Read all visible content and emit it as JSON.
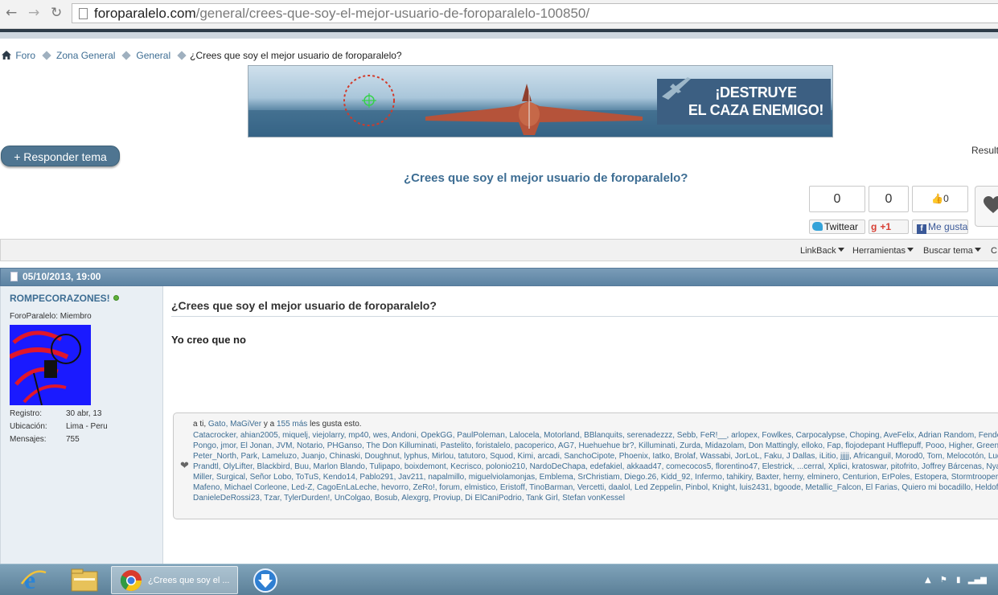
{
  "browser": {
    "url_host": "foroparalelo.com",
    "url_path": "/general/crees-que-soy-el-mejor-usuario-de-foroparalelo-100850/"
  },
  "breadcrumb": {
    "items": [
      "Foro",
      "Zona General",
      "General"
    ],
    "current": "¿Crees que soy el mejor usuario de foroparalelo?"
  },
  "banner": {
    "line1": "¡DESTRUYE",
    "line2": "EL CAZA ENEMIGO!"
  },
  "actions": {
    "reply_label": "+ Responder tema",
    "results_label": "Result"
  },
  "thread": {
    "title": "¿Crees que soy el mejor usuario de foroparalelo?"
  },
  "share": {
    "twitter_count": "0",
    "twitter_label": "Twittear",
    "gplus_count": "0",
    "gplus_label": "+1",
    "fb_count": "0",
    "fb_label": "Me gusta"
  },
  "toolbar": {
    "linkback": "LinkBack",
    "herramientas": "Herramientas",
    "buscar": "Buscar tema",
    "extra": "C"
  },
  "post": {
    "date": "05/10/2013, 19:00",
    "title": "¿Crees que soy el mejor usuario de foroparalelo?",
    "message": "Yo creo que no"
  },
  "user": {
    "name": "ROMPECORAZONES!",
    "title": "ForoParalelo: Miembro",
    "stats": [
      {
        "label": "Registro:",
        "value": "30 abr, 13"
      },
      {
        "label": "Ubicación:",
        "value": "Lima - Peru"
      },
      {
        "label": "Mensajes:",
        "value": "755"
      }
    ]
  },
  "likes": {
    "prefix": "a ti, ",
    "first_names": "Gato, MaGiVer",
    "middle": " y a ",
    "count_link": "155 más",
    "suffix": " les gusta esto.",
    "names": "Catacrocker, ahian2005, miquelj, viejolarry, mp40, wes, Andoni, OpekGG, PaulPoleman, Lalocela, Motorland, BBlanquits, serenadezzz, Sebb, FeR!__, arlopex, Fowlkes, Carpocalypse, Choping, AveFelix, Adrian Random, Fende, Pongo, jmor, El Jonan, JVM, Notario, PHGanso, The Don Killuminati, Pastelito, foristalelo, pacoperico, AG7, Huehuehue br?, Killuminati, Zurda, Midazolam, Don Mattingly, elloko, Fap, flojodepant Hufflepuff, Pooo, Higher, Green, Akyles, Peter_North, Park, Lameluzo, Juanjo, Chinaski, Doughnut, lyphus, Mirlou, tatutoro, Squod, Kimi, arcadi, SanchoCipote, Phoenix, Iatko, Brolaf, Wassabi, JorLoL, Faku, J Dallas, iLitio, jjjjj, Africanguil, Morod0, Tom, Melocotón, Ludwig Prandtl, OlyLifter, Blackbird, Buu, Marlon Blando, Tulipapo, boixdemont, Kecrisco, polonio210, NardoDeChapa, edefakiel, akkaad47, comecocos5, florentino47, Elestrick, ...cerral, Xplici, kratoswar, pitofrito, Joffrey Bárcenas, NyanCat, Miller, Surgical, Señor Lobo, ToTuS, Kendo14, Pablo291, Jav211, napalmillo, miguelviolamonjas, Emblema, SrChristiam, Diego.26, Kidd_92, Infermo, tahikiry, Baxter, herny, elminero, Centurion, ErPoles, Estopera, Stormtrooper, Death, Mafeno, Michael Corleone, Led-Z, CagoEnLaLeche, hevorro, ZeRo!, forum, elmistico, Eristoff, TinoBarman, Vercetti, daalol, Led Zeppelin, Pinbol, Knight, luis2431, bgoode, Metallic_Falcon, El Farias, Quiero mi bocadillo, Heldof, DanieleDeRossi23, Tzar, TylerDurden!, UnColgao, Bosub, Alexgrg, Proviup, Di ElCaniPodrio, Tank Girl, Stefan vonKessel"
  },
  "taskbar": {
    "chrome_label": "¿Crees que soy el ..."
  }
}
